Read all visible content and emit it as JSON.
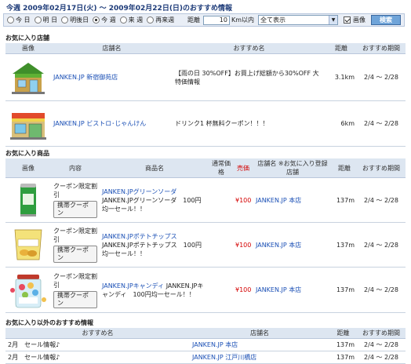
{
  "header": {
    "title": "今週 2009年02月17日(火) 〜 2009年02月22日(日)のおすすめ情報"
  },
  "filter": {
    "periods": [
      {
        "label": "今 日",
        "checked": false
      },
      {
        "label": "明 日",
        "checked": false
      },
      {
        "label": "明後日",
        "checked": false
      },
      {
        "label": "今 週",
        "checked": true
      },
      {
        "label": "来 週",
        "checked": false
      },
      {
        "label": "再来週",
        "checked": false
      }
    ],
    "distance_label": "距離",
    "distance_value": "10",
    "distance_unit": "Km以内",
    "display_selected": "全て表示",
    "image_label": "画像",
    "image_checked": true,
    "search_label": "検索"
  },
  "favorite_stores": {
    "heading": "お気に入り店舗",
    "columns": [
      "画像",
      "店舗名",
      "おすすめ名",
      "距離",
      "おすすめ期間"
    ],
    "rows": [
      {
        "image": "convenience-store-icon",
        "store": "JANKEN.JP 新宿御苑店",
        "recommend": "【雨の日 30%OFF】お買上げ総額から30%OFF 大特価情報",
        "distance": "3.1km",
        "period": "2/4 〜 2/28"
      },
      {
        "image": "bistro-storefront-icon",
        "store": "JANKEN.JP ビストロ･じゃんけん",
        "recommend": "ドリンク1 杯無料クーポン！！！",
        "distance": "6km",
        "period": "2/4 〜 2/28"
      }
    ]
  },
  "favorite_products": {
    "heading": "お気に入り商品",
    "columns": [
      "画像",
      "内容",
      "商品名",
      "通常価格",
      "売価",
      "店舗名 ※お気に入り登録店舗",
      "距離",
      "おすすめ期間"
    ],
    "coupon_button_label": "携帯クーポン",
    "rows": [
      {
        "image": "soda-can-icon",
        "content": "クーポン限定割引",
        "name": "JANKEN.JPグリーンソーダ",
        "desc": "JANKEN.JPグリーンソーダ　100円均一セール！！",
        "regular": "",
        "price": "¥100",
        "store": "JANKEN.JP 本店",
        "distance": "137m",
        "period": "2/4 〜 2/28"
      },
      {
        "image": "potato-chips-icon",
        "content": "クーポン限定割引",
        "name": "JANKEN.JPポテトチップス",
        "desc": "JANKEN.JPポテトチップス　100円均一セール！！",
        "regular": "",
        "price": "¥100",
        "store": "JANKEN.JP 本店",
        "distance": "137m",
        "period": "2/4 〜 2/28"
      },
      {
        "image": "candy-jar-icon",
        "content": "クーポン限定割引",
        "name": "JANKEN.JPキャンディ",
        "desc": "JANKEN.JPキャンディ　100円均一セール！！",
        "regular": "",
        "price": "¥100",
        "store": "JANKEN.JP 本店",
        "distance": "137m",
        "period": "2/4 〜 2/28"
      }
    ]
  },
  "other_recommend": {
    "heading": "お気に入り以外のおすすめ情報",
    "columns": [
      "おすすめ名",
      "店舗名",
      "距離",
      "おすすめ期間"
    ],
    "rows": [
      {
        "recommend": "2月　セール情報♪",
        "store": "JANKEN.JP 本店",
        "distance": "137m",
        "period": "2/4 〜 2/28"
      },
      {
        "recommend": "2月　セール情報♪",
        "store": "JANKEN.JP 江戸川橋店",
        "distance": "137m",
        "period": "2/4 〜 2/28"
      }
    ]
  }
}
